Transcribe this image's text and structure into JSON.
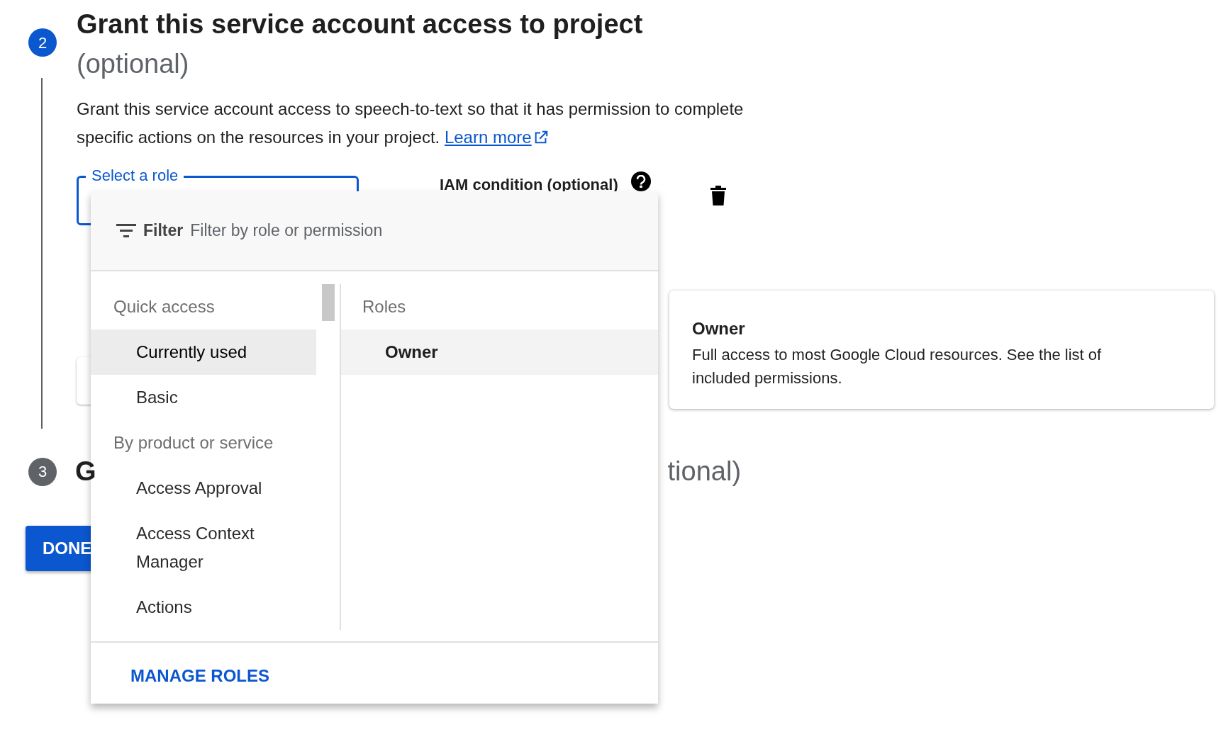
{
  "step2": {
    "number": "2",
    "title": "Grant this service account access to project",
    "title_optional": "(optional)",
    "description": "Grant this service account access to speech-to-text so that it has permission to complete specific actions on the resources in your project.",
    "link": "Learn more"
  },
  "role_field": {
    "label": "Select a role",
    "focused": true
  },
  "condition": {
    "label": "IAM condition (optional)"
  },
  "step3": {
    "number": "3",
    "title_start": "G",
    "title_end": "tional)"
  },
  "done_button": "DONE",
  "dropdown": {
    "filter_label": "Filter",
    "filter_placeholder": "Filter by role or permission",
    "categories": [
      {
        "kind": "header",
        "label": "Quick access"
      },
      {
        "kind": "item",
        "label": "Currently used",
        "selected": true
      },
      {
        "kind": "item",
        "label": "Basic",
        "selected": false
      },
      {
        "kind": "header",
        "label": "By product or service"
      },
      {
        "kind": "item",
        "label": "Access Approval",
        "selected": false
      },
      {
        "kind": "item",
        "label": "Access Context Manager",
        "selected": false
      },
      {
        "kind": "item",
        "label": "Actions",
        "selected": false
      }
    ],
    "roles_header": "Roles",
    "roles": [
      {
        "label": "Owner",
        "selected": true
      }
    ],
    "manage_roles": "MANAGE ROLES"
  },
  "role_info": {
    "title": "Owner",
    "description": "Full access to most Google Cloud resources. See the list of included permissions."
  }
}
